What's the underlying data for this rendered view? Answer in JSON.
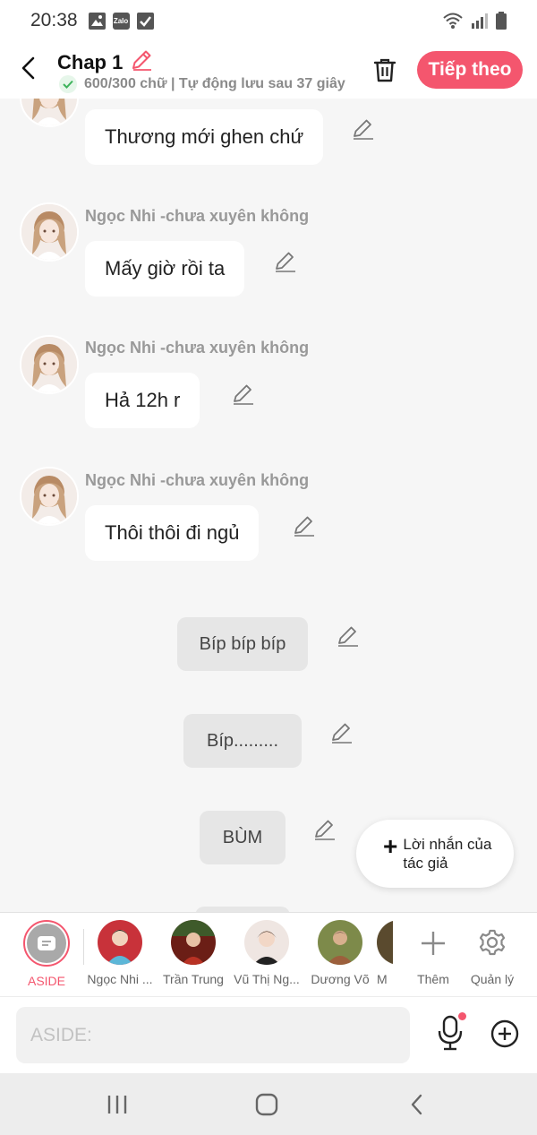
{
  "status_bar": {
    "time": "20:38",
    "zalo_label": "Zalo"
  },
  "header": {
    "title": "Chap 1",
    "subtitle": "600/300 chữ | Tự động lưu sau 37 giây",
    "next_label": "Tiếp theo"
  },
  "messages": [
    {
      "speaker": "",
      "text": "Thương mới ghen chứ"
    },
    {
      "speaker": "Ngọc Nhi -chưa xuyên không",
      "text": "Mấy giờ rồi ta"
    },
    {
      "speaker": "Ngọc Nhi -chưa xuyên không",
      "text": "Hả 12h r"
    },
    {
      "speaker": "Ngọc Nhi -chưa xuyên không",
      "text": "Thôi thôi đi ngủ"
    }
  ],
  "asides": [
    "Bíp bíp bíp",
    "Bíp.........",
    "BÙM"
  ],
  "fab": {
    "label": "Lời nhắn của tác giả"
  },
  "characters": {
    "aside_label": "ASIDE",
    "list": [
      "Ngọc Nhi ...",
      "Trần Trung",
      "Vũ Thị Ng...",
      "Dương Võ",
      "M"
    ],
    "more_label": "Thêm",
    "manage_label": "Quản lý"
  },
  "input": {
    "placeholder": "ASIDE:"
  },
  "colors": {
    "accent": "#f4566e",
    "bubble": "#ffffff",
    "aside_bubble": "#e6e6e6",
    "background": "#f6f6f6"
  }
}
